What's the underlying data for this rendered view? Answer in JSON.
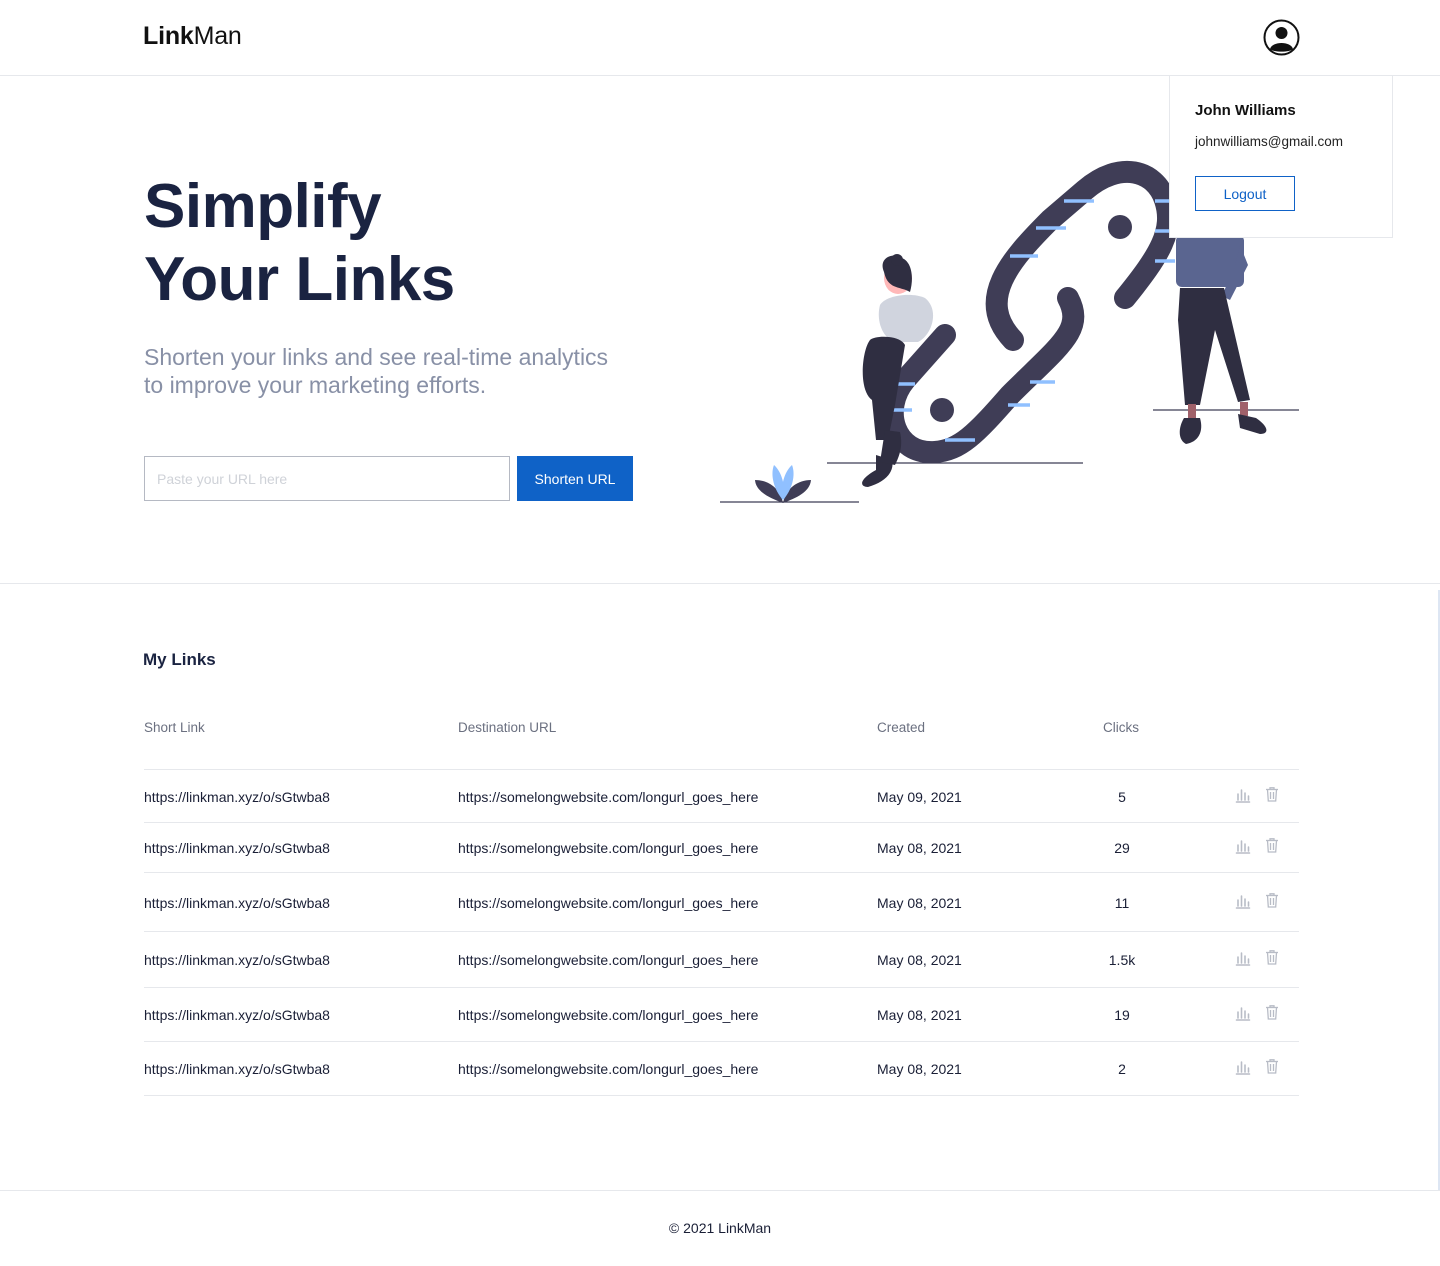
{
  "brand": {
    "bold": "Link",
    "light": "Man"
  },
  "user_menu": {
    "name": "John Williams",
    "email": "johnwilliams@gmail.com",
    "logout_label": "Logout"
  },
  "hero": {
    "title_line1": "Simplify",
    "title_line2": "Your Links",
    "subtitle_line1": "Shorten your links and see real-time analytics",
    "subtitle_line2": "to improve your marketing efforts.",
    "input_placeholder": "Paste your URL here",
    "button_label": "Shorten URL"
  },
  "links": {
    "title": "My Links",
    "headers": {
      "short": "Short Link",
      "dest": "Destination URL",
      "created": "Created",
      "clicks": "Clicks"
    },
    "rows": [
      {
        "short": "https://linkman.xyz/o/sGtwba8",
        "dest": "https://somelongwebsite.com/longurl_goes_here",
        "created": "May 09, 2021",
        "clicks": "5"
      },
      {
        "short": "https://linkman.xyz/o/sGtwba8",
        "dest": "https://somelongwebsite.com/longurl_goes_here",
        "created": "May 08, 2021",
        "clicks": "29"
      },
      {
        "short": "https://linkman.xyz/o/sGtwba8",
        "dest": "https://somelongwebsite.com/longurl_goes_here",
        "created": "May 08, 2021",
        "clicks": "11"
      },
      {
        "short": "https://linkman.xyz/o/sGtwba8",
        "dest": "https://somelongwebsite.com/longurl_goes_here",
        "created": "May 08, 2021",
        "clicks": "1.5k"
      },
      {
        "short": "https://linkman.xyz/o/sGtwba8",
        "dest": "https://somelongwebsite.com/longurl_goes_here",
        "created": "May 08, 2021",
        "clicks": "19"
      },
      {
        "short": "https://linkman.xyz/o/sGtwba8",
        "dest": "https://somelongwebsite.com/longurl_goes_here",
        "created": "May 08, 2021",
        "clicks": "2"
      }
    ],
    "row_icons": [
      "bar-chart-icon",
      "trash-icon"
    ]
  },
  "footer": {
    "text": "© 2021 LinkMan"
  },
  "colors": {
    "primary": "#0f62c7",
    "heading": "#1a2341",
    "muted": "#8890a6",
    "illustration_dark": "#3f3d56",
    "illustration_accent": "#90c0ff"
  }
}
